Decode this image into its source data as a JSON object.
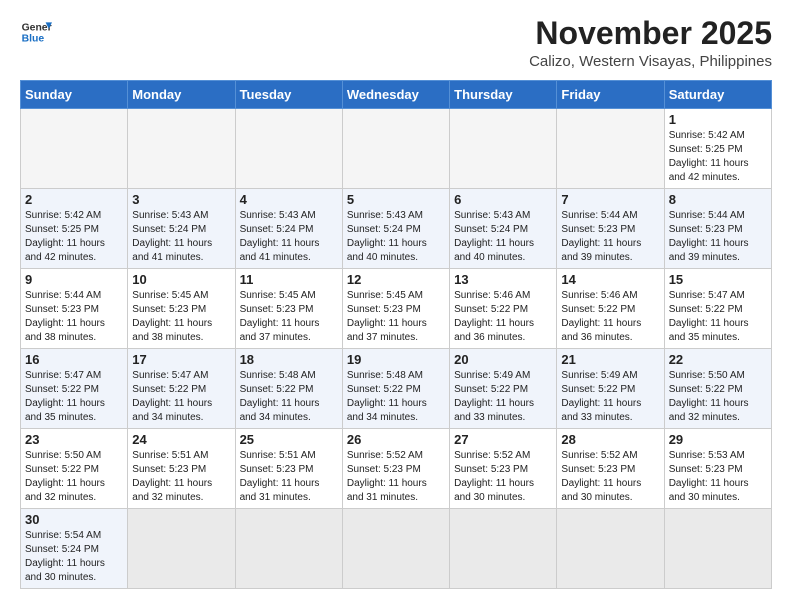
{
  "header": {
    "logo_general": "General",
    "logo_blue": "Blue",
    "title": "November 2025",
    "subtitle": "Calizo, Western Visayas, Philippines"
  },
  "weekdays": [
    "Sunday",
    "Monday",
    "Tuesday",
    "Wednesday",
    "Thursday",
    "Friday",
    "Saturday"
  ],
  "weeks": [
    [
      {
        "day": "",
        "info": ""
      },
      {
        "day": "",
        "info": ""
      },
      {
        "day": "",
        "info": ""
      },
      {
        "day": "",
        "info": ""
      },
      {
        "day": "",
        "info": ""
      },
      {
        "day": "",
        "info": ""
      },
      {
        "day": "1",
        "info": "Sunrise: 5:42 AM\nSunset: 5:25 PM\nDaylight: 11 hours\nand 42 minutes."
      }
    ],
    [
      {
        "day": "2",
        "info": "Sunrise: 5:42 AM\nSunset: 5:25 PM\nDaylight: 11 hours\nand 42 minutes."
      },
      {
        "day": "3",
        "info": "Sunrise: 5:43 AM\nSunset: 5:24 PM\nDaylight: 11 hours\nand 41 minutes."
      },
      {
        "day": "4",
        "info": "Sunrise: 5:43 AM\nSunset: 5:24 PM\nDaylight: 11 hours\nand 41 minutes."
      },
      {
        "day": "5",
        "info": "Sunrise: 5:43 AM\nSunset: 5:24 PM\nDaylight: 11 hours\nand 40 minutes."
      },
      {
        "day": "6",
        "info": "Sunrise: 5:43 AM\nSunset: 5:24 PM\nDaylight: 11 hours\nand 40 minutes."
      },
      {
        "day": "7",
        "info": "Sunrise: 5:44 AM\nSunset: 5:23 PM\nDaylight: 11 hours\nand 39 minutes."
      },
      {
        "day": "8",
        "info": "Sunrise: 5:44 AM\nSunset: 5:23 PM\nDaylight: 11 hours\nand 39 minutes."
      }
    ],
    [
      {
        "day": "9",
        "info": "Sunrise: 5:44 AM\nSunset: 5:23 PM\nDaylight: 11 hours\nand 38 minutes."
      },
      {
        "day": "10",
        "info": "Sunrise: 5:45 AM\nSunset: 5:23 PM\nDaylight: 11 hours\nand 38 minutes."
      },
      {
        "day": "11",
        "info": "Sunrise: 5:45 AM\nSunset: 5:23 PM\nDaylight: 11 hours\nand 37 minutes."
      },
      {
        "day": "12",
        "info": "Sunrise: 5:45 AM\nSunset: 5:23 PM\nDaylight: 11 hours\nand 37 minutes."
      },
      {
        "day": "13",
        "info": "Sunrise: 5:46 AM\nSunset: 5:22 PM\nDaylight: 11 hours\nand 36 minutes."
      },
      {
        "day": "14",
        "info": "Sunrise: 5:46 AM\nSunset: 5:22 PM\nDaylight: 11 hours\nand 36 minutes."
      },
      {
        "day": "15",
        "info": "Sunrise: 5:47 AM\nSunset: 5:22 PM\nDaylight: 11 hours\nand 35 minutes."
      }
    ],
    [
      {
        "day": "16",
        "info": "Sunrise: 5:47 AM\nSunset: 5:22 PM\nDaylight: 11 hours\nand 35 minutes."
      },
      {
        "day": "17",
        "info": "Sunrise: 5:47 AM\nSunset: 5:22 PM\nDaylight: 11 hours\nand 34 minutes."
      },
      {
        "day": "18",
        "info": "Sunrise: 5:48 AM\nSunset: 5:22 PM\nDaylight: 11 hours\nand 34 minutes."
      },
      {
        "day": "19",
        "info": "Sunrise: 5:48 AM\nSunset: 5:22 PM\nDaylight: 11 hours\nand 34 minutes."
      },
      {
        "day": "20",
        "info": "Sunrise: 5:49 AM\nSunset: 5:22 PM\nDaylight: 11 hours\nand 33 minutes."
      },
      {
        "day": "21",
        "info": "Sunrise: 5:49 AM\nSunset: 5:22 PM\nDaylight: 11 hours\nand 33 minutes."
      },
      {
        "day": "22",
        "info": "Sunrise: 5:50 AM\nSunset: 5:22 PM\nDaylight: 11 hours\nand 32 minutes."
      }
    ],
    [
      {
        "day": "23",
        "info": "Sunrise: 5:50 AM\nSunset: 5:22 PM\nDaylight: 11 hours\nand 32 minutes."
      },
      {
        "day": "24",
        "info": "Sunrise: 5:51 AM\nSunset: 5:23 PM\nDaylight: 11 hours\nand 32 minutes."
      },
      {
        "day": "25",
        "info": "Sunrise: 5:51 AM\nSunset: 5:23 PM\nDaylight: 11 hours\nand 31 minutes."
      },
      {
        "day": "26",
        "info": "Sunrise: 5:52 AM\nSunset: 5:23 PM\nDaylight: 11 hours\nand 31 minutes."
      },
      {
        "day": "27",
        "info": "Sunrise: 5:52 AM\nSunset: 5:23 PM\nDaylight: 11 hours\nand 30 minutes."
      },
      {
        "day": "28",
        "info": "Sunrise: 5:52 AM\nSunset: 5:23 PM\nDaylight: 11 hours\nand 30 minutes."
      },
      {
        "day": "29",
        "info": "Sunrise: 5:53 AM\nSunset: 5:23 PM\nDaylight: 11 hours\nand 30 minutes."
      }
    ],
    [
      {
        "day": "30",
        "info": "Sunrise: 5:54 AM\nSunset: 5:24 PM\nDaylight: 11 hours\nand 30 minutes."
      },
      {
        "day": "",
        "info": ""
      },
      {
        "day": "",
        "info": ""
      },
      {
        "day": "",
        "info": ""
      },
      {
        "day": "",
        "info": ""
      },
      {
        "day": "",
        "info": ""
      },
      {
        "day": "",
        "info": ""
      }
    ]
  ]
}
